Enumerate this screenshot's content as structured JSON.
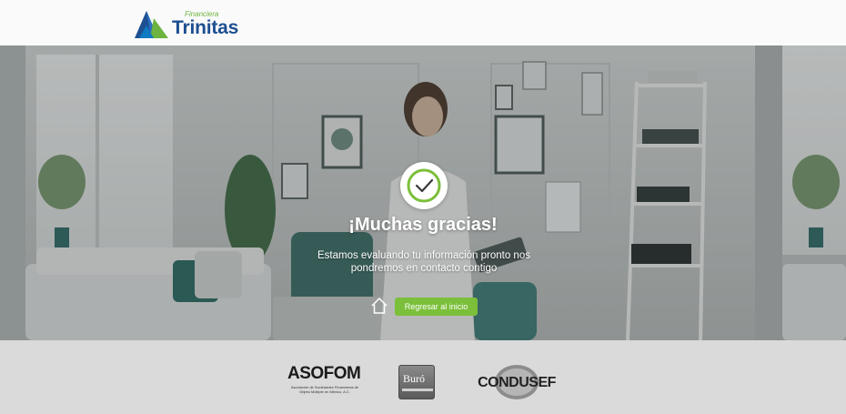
{
  "header": {
    "brand_tagline": "Financiera",
    "brand_name": "Trinitas"
  },
  "hero": {
    "title": "¡Muchas gracias!",
    "message": "Estamos evaluando tu información pronto nos pondremos en contacto contigo",
    "back_button_label": "Regresar al inicio",
    "icons": [
      "check-icon",
      "home-icon"
    ]
  },
  "footer": {
    "asofom": {
      "name": "ASOFOM",
      "description": "Asociación de Sociedades Financieras de Objeto Múltiple en México, A.C."
    },
    "buro": {
      "name": "Buró"
    },
    "condusef": {
      "name": "CONDUSEF"
    }
  },
  "colors": {
    "brand_blue": "#1d4f91",
    "brand_green": "#6cb33f",
    "button_green": "#7bbf3a",
    "footer_bg": "#dadada"
  }
}
